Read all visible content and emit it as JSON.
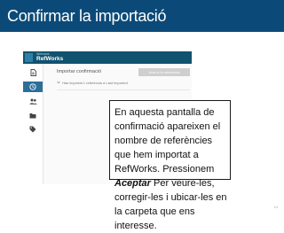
{
  "slide": {
    "title": "Confirmar la importació",
    "page_number": "14"
  },
  "app": {
    "logo_small": "Welcome",
    "logo_name": "RefWorks",
    "nav": [
      {
        "icon": "document-icon"
      },
      {
        "icon": "recent-icon",
        "active": true
      },
      {
        "icon": "people-icon"
      },
      {
        "icon": "folder-icon"
      },
      {
        "icon": "tag-icon"
      }
    ],
    "import_title": "Importar confirmació",
    "import_action": "Anar a la referència",
    "import_summary": "Has importat 1 referència a Last Imported"
  },
  "callout": {
    "text_before": "En aquesta pantalla de confirmació apareixen el nombre de referències que hem importat a RefWorks. Pressionem ",
    "emphasis": "Aceptar",
    "text_after": " Per veure-les, corregir-les i ubicar-les en la carpeta que ens interesse."
  },
  "colors": {
    "banner": "#0b4a78",
    "app_header": "#10526f",
    "active_nav": "#2c6f99"
  }
}
